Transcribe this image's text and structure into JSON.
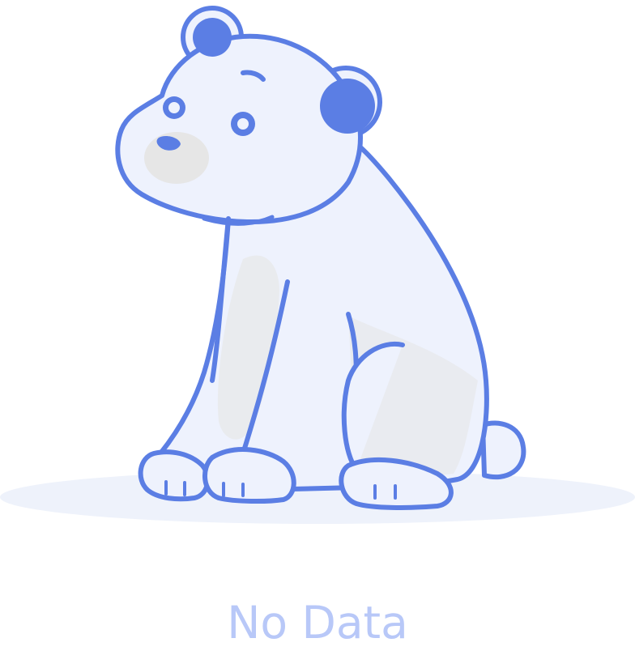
{
  "empty_state": {
    "message": "No Data",
    "illustration": "polar-bear-icon",
    "colors": {
      "outline": "#5b7ee4",
      "fur": "#eef2fd",
      "fur_shadow": "#e6e6e6",
      "ground": "#eef2fb",
      "text": "#b8c8f8"
    }
  }
}
